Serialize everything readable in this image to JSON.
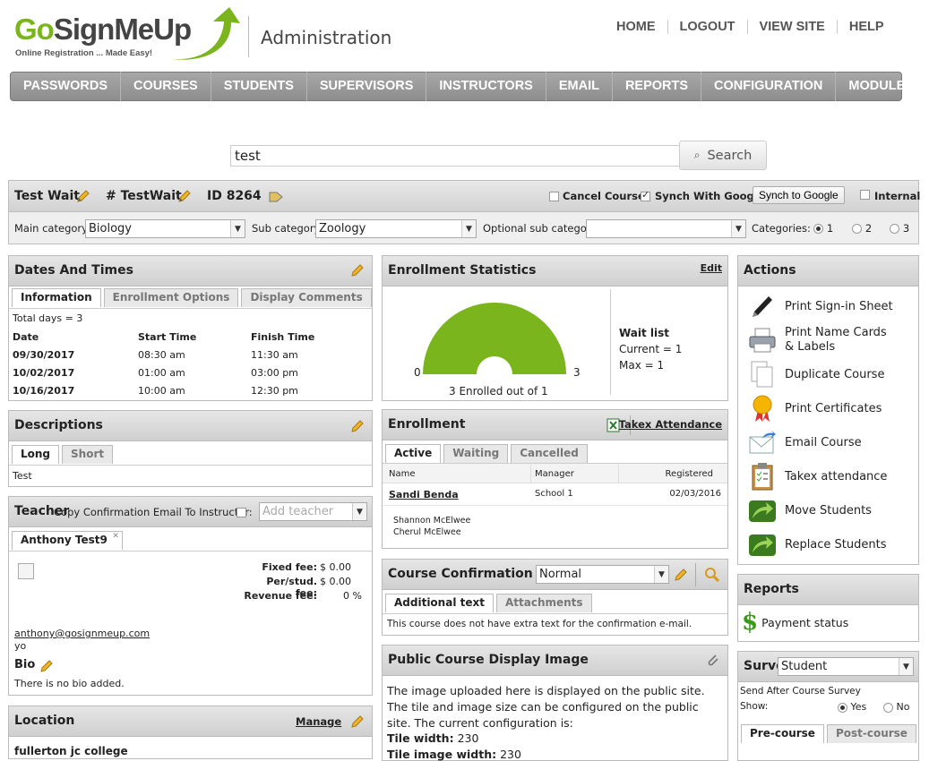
{
  "brand": {
    "name_go": "Go",
    "name_rest": "SignMeUp",
    "tagline": "Online Registration ... Made Easy!",
    "section": "Administration"
  },
  "topnav": [
    "HOME",
    "LOGOUT",
    "VIEW SITE",
    "HELP"
  ],
  "menu": [
    "PASSWORDS",
    "COURSES",
    "STUDENTS",
    "SUPERVISORS",
    "INSTRUCTORS",
    "EMAIL",
    "REPORTS",
    "CONFIGURATION",
    "MODULES"
  ],
  "search": {
    "value": "test",
    "button": "Search"
  },
  "course": {
    "name": "Test Wait",
    "number": "# TestWait",
    "id": "ID 8264",
    "cancel_label": "Cancel Course",
    "synch_label": "Synch With Google",
    "synch_button": "Synch to Google",
    "internal_label": "Internal"
  },
  "categories": {
    "main_label": "Main category:",
    "main_value": "Biology",
    "sub_label": "Sub category:",
    "sub_value": "Zoology",
    "opt_label": "Optional sub category:",
    "opt_value": "",
    "cats_label": "Categories:",
    "options": [
      "1",
      "2",
      "3"
    ]
  },
  "dates": {
    "title": "Dates And Times",
    "tabs": [
      "Information",
      "Enrollment Options",
      "Display Comments"
    ],
    "total": "Total days = 3",
    "headers": [
      "Date",
      "Start Time",
      "Finish Time"
    ],
    "rows": [
      [
        "09/30/2017",
        "08:30 am",
        "11:30 am"
      ],
      [
        "10/02/2017",
        "01:00 am",
        "03:00 pm"
      ],
      [
        "10/16/2017",
        "10:00 am",
        "12:30 pm"
      ]
    ]
  },
  "descriptions": {
    "title": "Descriptions",
    "tabs": [
      "Long",
      "Short"
    ],
    "text": "Test"
  },
  "teacher": {
    "title": "Teacher",
    "copy_label": "Copy Confirmation Email To Instructor:",
    "add_placeholder": "Add teacher",
    "tab": "Anthony Test9",
    "fixed_label": "Fixed fee:",
    "fixed_value": "$  0.00",
    "perstud_label": "Per/stud. fee:",
    "perstud_value": "$  0.00",
    "revenue_label": "Revenue fee:",
    "revenue_value": "0  %",
    "email": "anthony@gosignmeup.com",
    "yo": "yo",
    "bio_title": "Bio",
    "bio_text": "There is no bio added."
  },
  "location": {
    "title": "Location",
    "manage": "Manage",
    "name": "fullerton jc college"
  },
  "stats": {
    "title": "Enrollment Statistics",
    "edit": "Edit",
    "min": "0",
    "max": "3",
    "enrolled_text": "3 Enrolled out of 1",
    "enrolled": 3,
    "capacity": 3,
    "wait_title": "Wait list",
    "wait_current": "Current = 1",
    "wait_max": "Max = 1",
    "gauge_color": "#7ab51d"
  },
  "enrollment": {
    "title": "Enrollment",
    "takex": "Takex Attendance",
    "tabs": [
      "Active",
      "Waiting",
      "Cancelled"
    ],
    "headers": [
      "Name",
      "Manager",
      "Registered"
    ],
    "student": "Sandi Benda",
    "manager": "School 1",
    "registered": "02/03/2016",
    "extra1": "Shannon McElwee",
    "extra2": "Cherul McElwee"
  },
  "confirmation": {
    "title": "Course Confirmation E-M",
    "select_value": "Normal",
    "tabs": [
      "Additional text",
      "Attachments"
    ],
    "text": "This course does not have extra text for the confirmation e-mail."
  },
  "public_image": {
    "title": "Public Course Display Image",
    "text": "The image uploaded here is displayed on the public site. The tile and image size can be configured on the public site. The current configuration is:",
    "tile_width_label": "Tile width:",
    "tile_width": "230",
    "tile_image_label": "Tile image width:",
    "tile_image": "230"
  },
  "actions": {
    "title": "Actions",
    "items": [
      "Print Sign-in Sheet",
      "Print Name Cards & Labels",
      "Duplicate Course",
      "Print Certificates",
      "Email Course",
      "Takex attendance",
      "Move Students",
      "Replace Students"
    ]
  },
  "reports": {
    "title": "Reports",
    "item": "Payment status"
  },
  "survey": {
    "title": "Surve",
    "select_value": "Student",
    "send_after": "Send After Course Survey",
    "show_label": "Show:",
    "yes": "Yes",
    "no": "No",
    "tabs": [
      "Pre-course",
      "Post-course"
    ]
  }
}
